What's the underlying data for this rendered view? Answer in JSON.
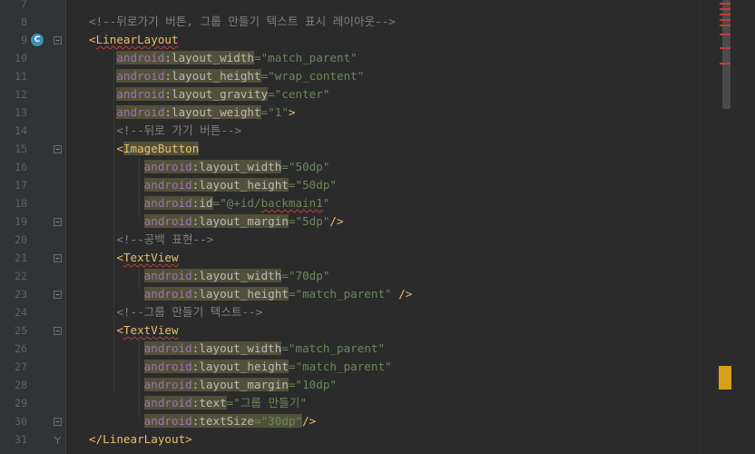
{
  "editor": {
    "lines": [
      {
        "num": "7",
        "segments": []
      },
      {
        "num": "8",
        "segments": [
          {
            "t": "<!--뒤로가기 버튼, 그룹 만들기 텍스트 표시 레이아웃-->",
            "c": "c-comment"
          }
        ]
      },
      {
        "num": "9",
        "segments": [
          {
            "t": "<",
            "c": "c-br"
          },
          {
            "t": "LinearLayout",
            "c": "c-tag-err"
          }
        ]
      },
      {
        "num": "10",
        "segments": [
          {
            "t": "    "
          },
          {
            "t": "android",
            "c": "c-ns hl"
          },
          {
            "t": ":layout_width",
            "c": "c-attr hl"
          },
          {
            "t": "=\"match_parent\"",
            "c": "c-val"
          }
        ]
      },
      {
        "num": "11",
        "segments": [
          {
            "t": "    "
          },
          {
            "t": "android",
            "c": "c-ns hl"
          },
          {
            "t": ":layout_height",
            "c": "c-attr hl"
          },
          {
            "t": "=\"wrap_content\"",
            "c": "c-val"
          }
        ]
      },
      {
        "num": "12",
        "segments": [
          {
            "t": "    "
          },
          {
            "t": "android",
            "c": "c-ns hl"
          },
          {
            "t": ":layout_gravity",
            "c": "c-attr hl"
          },
          {
            "t": "=\"center\"",
            "c": "c-val"
          }
        ]
      },
      {
        "num": "13",
        "segments": [
          {
            "t": "    "
          },
          {
            "t": "android",
            "c": "c-ns hl"
          },
          {
            "t": ":layout_weight",
            "c": "c-attr hl"
          },
          {
            "t": "=\"1\"",
            "c": "c-val"
          },
          {
            "t": ">",
            "c": "c-br"
          }
        ]
      },
      {
        "num": "14",
        "segments": [
          {
            "t": "    "
          },
          {
            "t": "<!--뒤로 가기 버튼-->",
            "c": "c-comment"
          }
        ]
      },
      {
        "num": "15",
        "segments": [
          {
            "t": "    "
          },
          {
            "t": "<",
            "c": "c-br"
          },
          {
            "t": "ImageButton",
            "c": "c-tag hl"
          }
        ]
      },
      {
        "num": "16",
        "segments": [
          {
            "t": "        "
          },
          {
            "t": "android",
            "c": "c-ns hl"
          },
          {
            "t": ":layout_width",
            "c": "c-attr hl"
          },
          {
            "t": "=\"50dp\"",
            "c": "c-val"
          }
        ]
      },
      {
        "num": "17",
        "segments": [
          {
            "t": "        "
          },
          {
            "t": "android",
            "c": "c-ns hl"
          },
          {
            "t": ":layout_height",
            "c": "c-attr hl"
          },
          {
            "t": "=\"50dp\"",
            "c": "c-val"
          }
        ]
      },
      {
        "num": "18",
        "segments": [
          {
            "t": "        "
          },
          {
            "t": "android",
            "c": "c-ns hl"
          },
          {
            "t": ":id",
            "c": "c-attr hl"
          },
          {
            "t": "=\"@+id/",
            "c": "c-val"
          },
          {
            "t": "backmain1",
            "c": "c-val val-err"
          },
          {
            "t": "\"",
            "c": "c-val"
          }
        ]
      },
      {
        "num": "19",
        "segments": [
          {
            "t": "        "
          },
          {
            "t": "android",
            "c": "c-ns hl"
          },
          {
            "t": ":layout_margin",
            "c": "c-attr hl"
          },
          {
            "t": "=\"5dp\"",
            "c": "c-val"
          },
          {
            "t": "/>",
            "c": "c-br"
          }
        ]
      },
      {
        "num": "20",
        "segments": [
          {
            "t": "    "
          },
          {
            "t": "<!--공백 표현-->",
            "c": "c-comment"
          }
        ]
      },
      {
        "num": "21",
        "segments": [
          {
            "t": "    "
          },
          {
            "t": "<",
            "c": "c-br"
          },
          {
            "t": "TextView",
            "c": "c-tag-err"
          }
        ]
      },
      {
        "num": "22",
        "segments": [
          {
            "t": "        "
          },
          {
            "t": "android",
            "c": "c-ns hl"
          },
          {
            "t": ":layout_width",
            "c": "c-attr hl"
          },
          {
            "t": "=\"70dp\"",
            "c": "c-val"
          }
        ]
      },
      {
        "num": "23",
        "segments": [
          {
            "t": "        "
          },
          {
            "t": "android",
            "c": "c-ns hl"
          },
          {
            "t": ":layout_height",
            "c": "c-attr hl"
          },
          {
            "t": "=\"match_parent\"",
            "c": "c-val"
          },
          {
            "t": " />",
            "c": "c-br"
          }
        ]
      },
      {
        "num": "24",
        "segments": [
          {
            "t": "    "
          },
          {
            "t": "<!--그룹 만들기 텍스트-->",
            "c": "c-comment"
          }
        ]
      },
      {
        "num": "25",
        "segments": [
          {
            "t": "    "
          },
          {
            "t": "<",
            "c": "c-br"
          },
          {
            "t": "TextView",
            "c": "c-tag-err"
          }
        ]
      },
      {
        "num": "26",
        "segments": [
          {
            "t": "        "
          },
          {
            "t": "android",
            "c": "c-ns hl"
          },
          {
            "t": ":layout_width",
            "c": "c-attr hl"
          },
          {
            "t": "=\"match_parent\"",
            "c": "c-val"
          }
        ]
      },
      {
        "num": "27",
        "segments": [
          {
            "t": "        "
          },
          {
            "t": "android",
            "c": "c-ns hl"
          },
          {
            "t": ":layout_height",
            "c": "c-attr hl"
          },
          {
            "t": "=\"match_parent\"",
            "c": "c-val"
          }
        ]
      },
      {
        "num": "28",
        "segments": [
          {
            "t": "        "
          },
          {
            "t": "android",
            "c": "c-ns hl"
          },
          {
            "t": ":layout_margin",
            "c": "c-attr hl"
          },
          {
            "t": "=\"10dp\"",
            "c": "c-val"
          }
        ]
      },
      {
        "num": "29",
        "segments": [
          {
            "t": "        "
          },
          {
            "t": "android",
            "c": "c-ns hl"
          },
          {
            "t": ":text",
            "c": "c-attr hl"
          },
          {
            "t": "=\"그룹 만들기\"",
            "c": "c-val"
          }
        ]
      },
      {
        "num": "30",
        "segments": [
          {
            "t": "        "
          },
          {
            "t": "android",
            "c": "c-ns hl"
          },
          {
            "t": ":textSize",
            "c": "c-attr hl"
          },
          {
            "t": "=\"30dp\"",
            "c": "c-val hl"
          },
          {
            "t": "/>",
            "c": "c-br"
          }
        ]
      },
      {
        "num": "31",
        "segments": [
          {
            "t": "</",
            "c": "c-br"
          },
          {
            "t": "LinearLayout",
            "c": "c-tag"
          },
          {
            "t": ">",
            "c": "c-br"
          }
        ]
      }
    ],
    "gutter": {
      "badge_letter": "C",
      "fold_lines": [
        "9",
        "15",
        "19",
        "21",
        "23",
        "25",
        "30",
        "31"
      ]
    }
  },
  "scrollbar": {
    "error_stripes": 8,
    "warning_stripe": true
  },
  "colors": {
    "background": "#2b2b2b",
    "comment": "#808080",
    "tag": "#e8bf6a",
    "namespace": "#9876aa",
    "value": "#6a8759",
    "error": "#bc3f3c",
    "warning": "#d6a11a"
  }
}
